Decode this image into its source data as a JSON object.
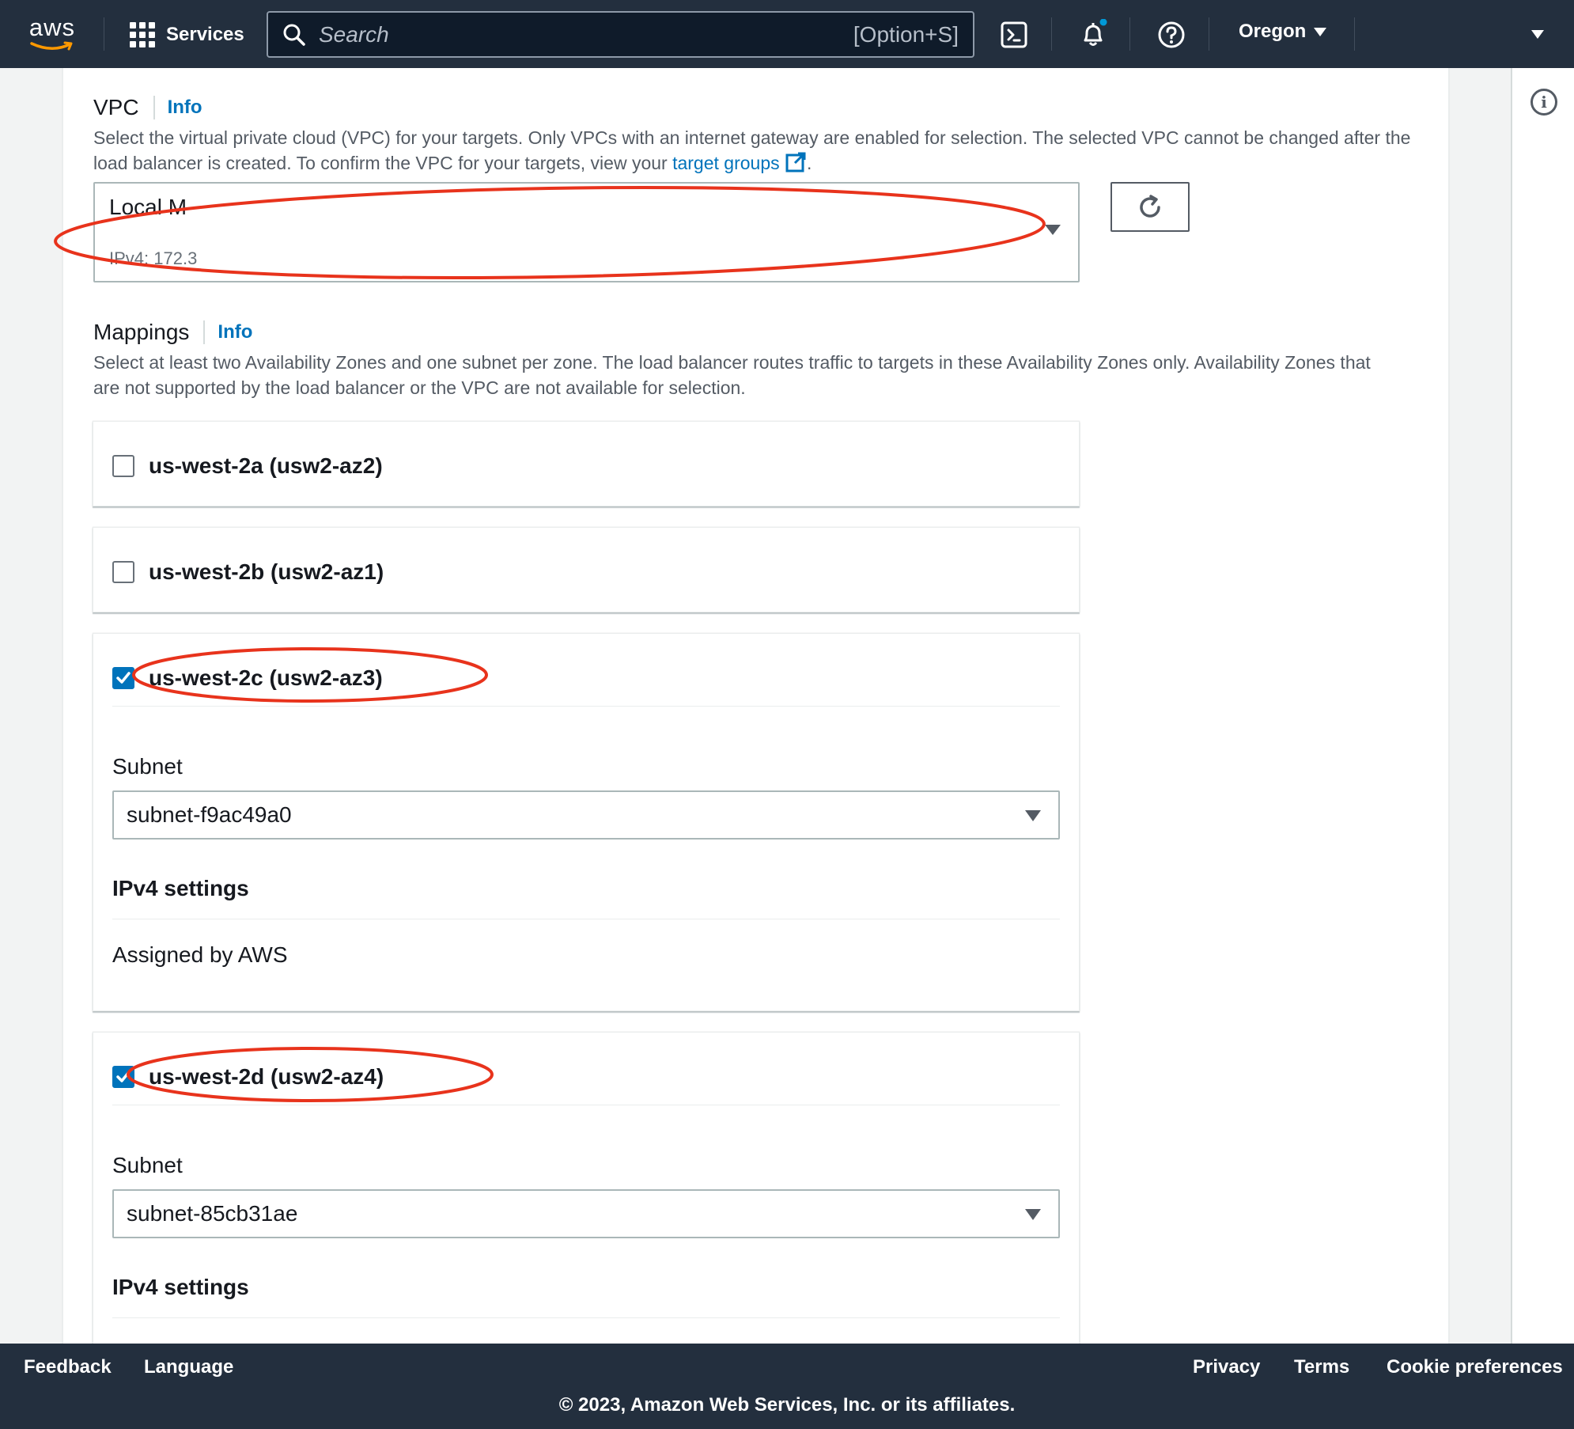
{
  "nav": {
    "logo_text": "aws",
    "services_label": "Services",
    "search_placeholder": "Search",
    "search_shortcut": "[Option+S]",
    "region_label": "Oregon"
  },
  "vpc": {
    "label": "VPC",
    "info_label": "Info",
    "description_part1": "Select the virtual private cloud (VPC) for your targets. Only VPCs with an internet gateway are enabled for selection. The selected VPC cannot be changed after the load balancer is created. To confirm the VPC for your targets, view your ",
    "description_link": "target groups",
    "description_end": ".",
    "selected_name": "Local M",
    "selected_detail": "IPv4: 172.3"
  },
  "mappings": {
    "label": "Mappings",
    "info_label": "Info",
    "description": "Select at least two Availability Zones and one subnet per zone. The load balancer routes traffic to targets in these Availability Zones only. Availability Zones that are not supported by the load balancer or the VPC are not available for selection.",
    "zones": [
      {
        "name": "us-west-2a (usw2-az2)",
        "checked": false
      },
      {
        "name": "us-west-2b (usw2-az1)",
        "checked": false
      },
      {
        "name": "us-west-2c (usw2-az3)",
        "checked": true,
        "subnet_label": "Subnet",
        "subnet_value": "subnet-f9ac49a0",
        "ipv4_title": "IPv4 settings",
        "ipv4_value": "Assigned by AWS"
      },
      {
        "name": "us-west-2d (usw2-az4)",
        "checked": true,
        "subnet_label": "Subnet",
        "subnet_value": "subnet-85cb31ae",
        "ipv4_title": "IPv4 settings"
      }
    ]
  },
  "annotation_color": "#e8331c",
  "footer": {
    "feedback": "Feedback",
    "language": "Language",
    "privacy": "Privacy",
    "terms": "Terms",
    "cookie": "Cookie preferences",
    "copyright": "© 2023, Amazon Web Services, Inc. or its affiliates."
  }
}
